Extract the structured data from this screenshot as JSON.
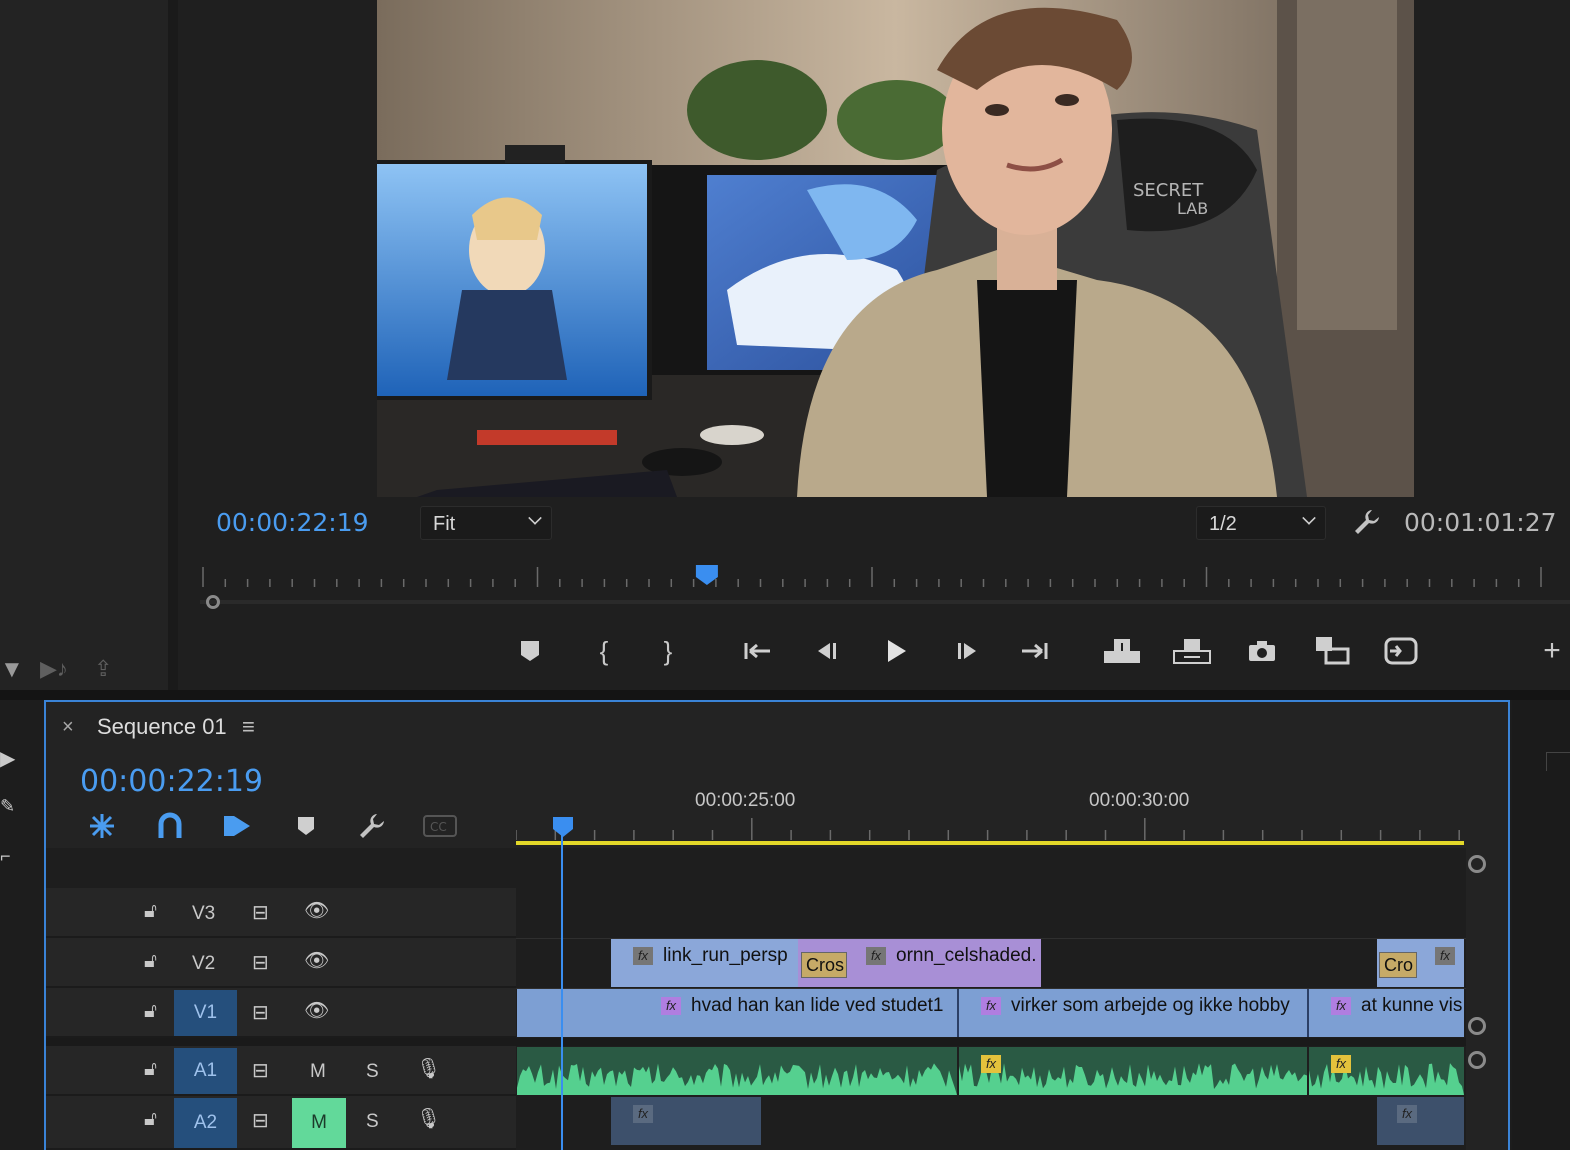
{
  "program_monitor": {
    "current_timecode": "00:00:22:19",
    "duration_timecode": "00:01:01:27",
    "fit_label": "Fit",
    "resolution_label": "1/2",
    "video_overlay_text": {
      "chair_brand_line1": "SECRET",
      "chair_brand_line2": "LAB"
    },
    "playhead_position": 0.37,
    "transport": {
      "marker": "add-marker-icon",
      "mark_in": "mark-in-icon",
      "mark_out": "mark-out-icon",
      "go_to_in": "go-to-in-icon",
      "step_back": "step-back-icon",
      "play": "play-icon",
      "step_forward": "step-forward-icon",
      "go_to_out": "go-to-out-icon",
      "lift": "lift-icon",
      "extract": "extract-icon",
      "export_frame": "camera-icon",
      "insert": "insert-icon",
      "overwrite": "overwrite-icon",
      "add": "plus-icon"
    }
  },
  "timeline": {
    "sequence_name": "Sequence 01",
    "timecode": "00:00:22:19",
    "ruler": {
      "mark_25": "00:00:25:00",
      "mark_30": "00:00:30:00"
    },
    "tracks": [
      {
        "name": "V3",
        "type": "video",
        "targeted": false
      },
      {
        "name": "V2",
        "type": "video",
        "targeted": false
      },
      {
        "name": "V1",
        "type": "video",
        "targeted": true
      },
      {
        "name": "A1",
        "type": "audio",
        "targeted": true,
        "mute_label": "M",
        "solo_label": "S",
        "muted": false
      },
      {
        "name": "A2",
        "type": "audio",
        "targeted": true,
        "mute_label": "M",
        "solo_label": "S",
        "muted": true
      }
    ],
    "clips": {
      "v2_clip1": "link_run_persp",
      "v2_clip2": "ornn_celshaded.",
      "v2_cross1": "Cros",
      "v2_cross2": "Cro",
      "v1_clip1": "hvad han kan lide ved studet1",
      "v1_clip2": "virker som arbejde og ikke hobby",
      "v1_clip3": "at kunne vis",
      "fx_label": "fx"
    },
    "colors": {
      "accent_blue": "#4a9cf0",
      "work_area": "#e3d829",
      "audio_wave": "#55d08f",
      "mute_on": "#62d99a"
    }
  }
}
